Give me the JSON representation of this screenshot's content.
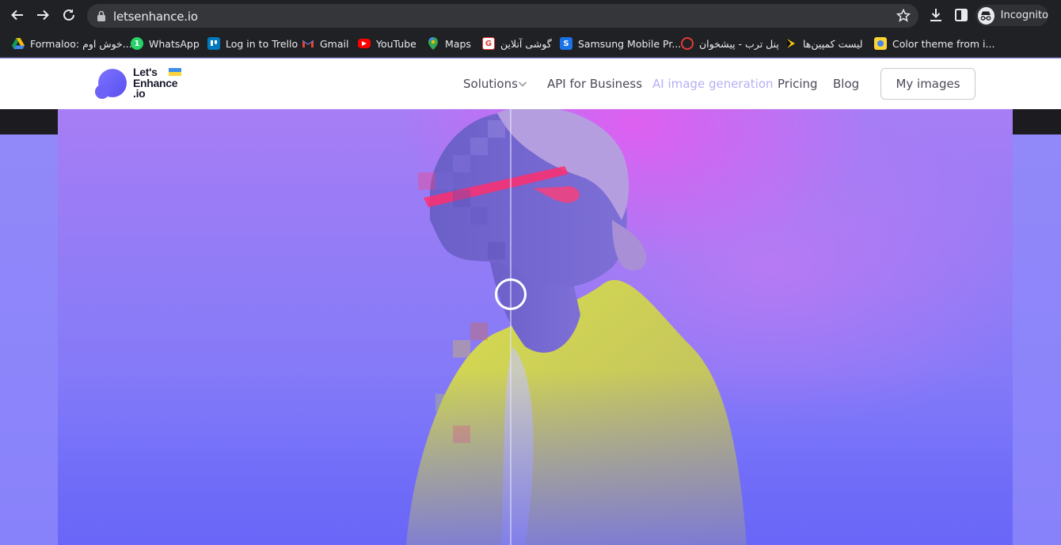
{
  "browser": {
    "url": "letsenhance.io",
    "incognito_label": "Incognito",
    "bookmarks": [
      {
        "label": "Formaloo: خوش اوم...",
        "icon": "google-drive-icon"
      },
      {
        "label": "WhatsApp",
        "icon": "whatsapp-icon"
      },
      {
        "label": "Log in to Trello",
        "icon": "trello-icon"
      },
      {
        "label": "Gmail",
        "icon": "gmail-icon"
      },
      {
        "label": "YouTube",
        "icon": "youtube-icon"
      },
      {
        "label": "Maps",
        "icon": "maps-icon"
      },
      {
        "label": "گوشی آنلاین",
        "icon": "site-icon"
      },
      {
        "label": "Samsung Mobile Pr...",
        "icon": "samsung-icon"
      },
      {
        "label": "پنل ترب - پیشخوان",
        "icon": "torob-icon"
      },
      {
        "label": "لیست کمپین‌ها",
        "icon": "campaign-icon"
      },
      {
        "label": "Color theme from i...",
        "icon": "color-theme-icon"
      }
    ]
  },
  "site": {
    "logo": {
      "line1": "Let's",
      "line2": "Enhance",
      "line3": ".io"
    },
    "nav": {
      "solutions": "Solutions",
      "api": "API for Business",
      "ai_generation": "AI image generation",
      "pricing": "Pricing",
      "blog": "Blog",
      "my_images": "My images"
    }
  },
  "hero": {
    "comparison_split_percent": 47.5
  },
  "colors": {
    "brand": "#6a5cf5",
    "nav_active": "#b3b0f5",
    "chrome_bg": "#202124"
  }
}
